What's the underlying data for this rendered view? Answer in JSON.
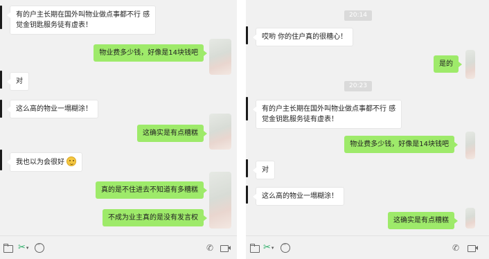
{
  "left_chat": {
    "messages": [
      {
        "side": "in",
        "text_lines": [
          "有的户主长期在国外叫物业做点事都不行 感",
          "觉金钥匙服务徒有虚表！"
        ]
      },
      {
        "side": "out",
        "text": "物业费多少钱，好像是14块钱吧"
      },
      {
        "side": "in",
        "text": "对"
      },
      {
        "side": "in",
        "text": "这么高的物业一塌糊涂！"
      },
      {
        "side": "out",
        "text": "这确实是有点糟糕"
      },
      {
        "side": "in",
        "text": "我也以为会很好",
        "emoji": "smile-emoji"
      },
      {
        "side": "out",
        "text": "真的是不住进去不知道有多糟糕"
      },
      {
        "side": "out",
        "text": "不成为业主真的是没有发言权"
      }
    ]
  },
  "right_chat": {
    "timestamps": [
      "20:14",
      "20:23"
    ],
    "messages": [
      {
        "side": "in",
        "text": "哎哟 你的住户真的很糟心！"
      },
      {
        "side": "out",
        "text": "是的"
      },
      {
        "side": "in",
        "text_lines": [
          "有的户主长期在国外叫物业做点事都不行 感",
          "觉金钥匙服务徒有虚表！"
        ]
      },
      {
        "side": "out",
        "text": "物业费多少钱，好像是14块钱吧"
      },
      {
        "side": "in",
        "text": "对"
      },
      {
        "side": "in",
        "text": "这么高的物业一塌糊涂！"
      },
      {
        "side": "out",
        "text": "这确实是有点糟糕"
      }
    ]
  },
  "toolbar": {
    "icons": [
      "folder-icon",
      "scissors-icon",
      "emoji-icon",
      "phone-icon",
      "video-icon"
    ],
    "scissors_glyph": "✂",
    "caret_glyph": "▾",
    "phone_glyph": "✆"
  },
  "colors": {
    "chat_background": "#f1f1f1",
    "incoming_bubble": "#ffffff",
    "outgoing_bubble": "#9eea6a",
    "timestamp_badge": "#dadada",
    "scissors_accent": "#2aae67"
  }
}
